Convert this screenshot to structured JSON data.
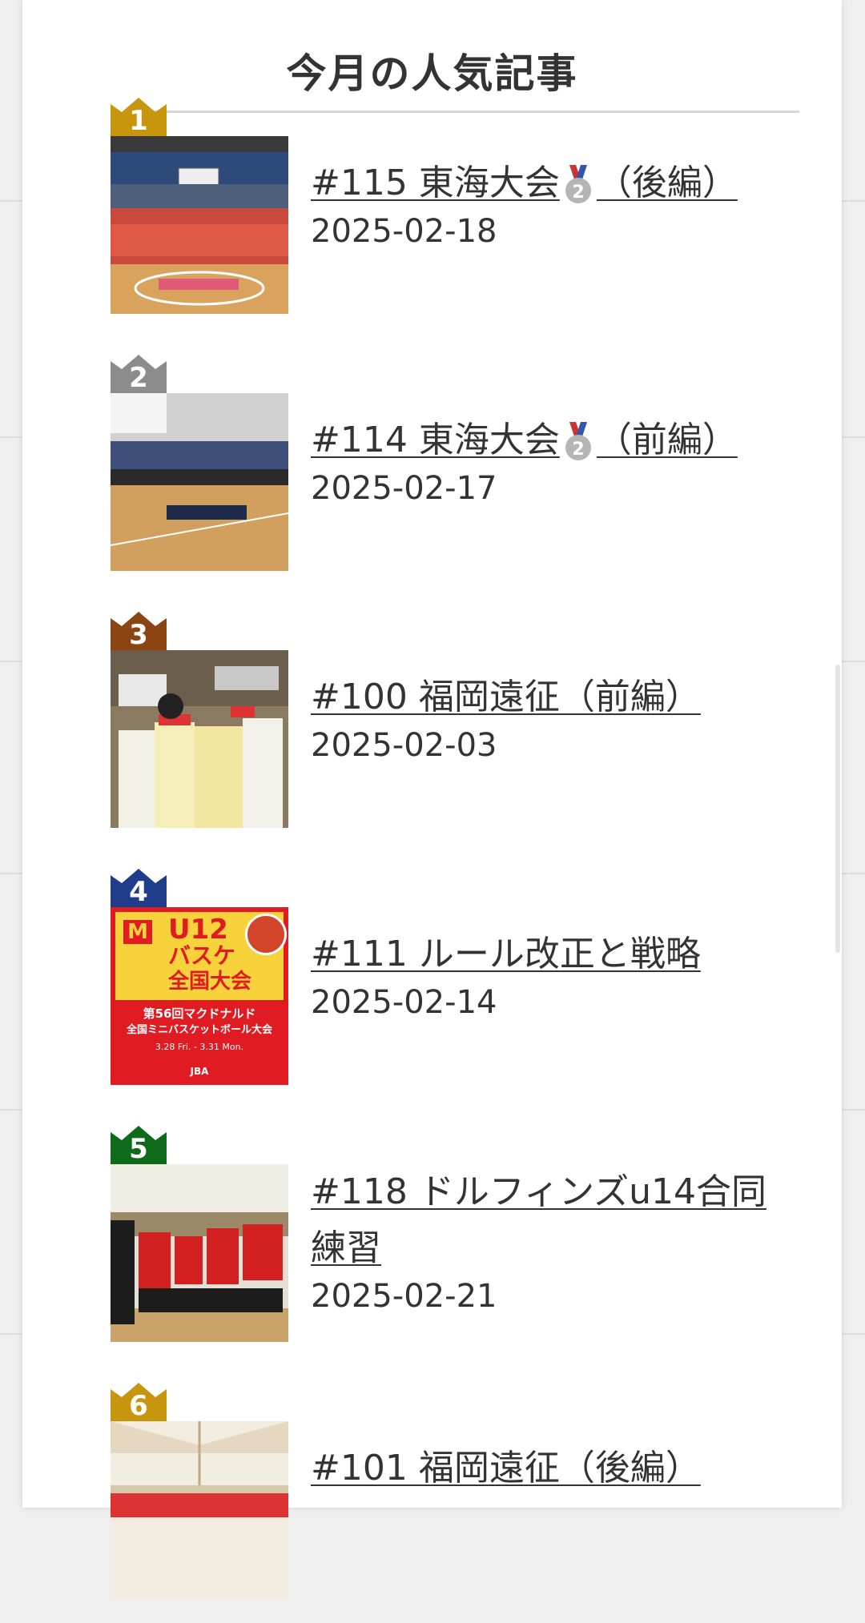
{
  "section_title": "今月の人気記事",
  "crown_colors": {
    "gold": "#c8960c",
    "silver": "#8c8c8c",
    "bronze": "#8b4513",
    "blue": "#1f3d8a",
    "green": "#0d6b1a"
  },
  "articles": [
    {
      "rank": "1",
      "title_before": "#115 東海大会",
      "medal_icon": "silver-medal-2",
      "title_after": "（後編）",
      "date": "2025-02-18"
    },
    {
      "rank": "2",
      "title_before": "#114 東海大会",
      "medal_icon": "silver-medal-2",
      "title_after": "（前編）",
      "date": "2025-02-17"
    },
    {
      "rank": "3",
      "title": "#100 福岡遠征（前編）",
      "date": "2025-02-03"
    },
    {
      "rank": "4",
      "title": "#111 ルール改正と戦略",
      "date": "2025-02-14",
      "poster": {
        "logo": "M",
        "line1": "U12",
        "line2": "バスケ",
        "line3": "全国大会",
        "line4": "第56回マクドナルド",
        "line5": "全国ミニバスケットボール大会",
        "dates": "3.28 Fri. - 3.31 Mon.",
        "footer": "JBA"
      }
    },
    {
      "rank": "5",
      "title": "#118 ドルフィンズu14合同練習",
      "date": "2025-02-21"
    },
    {
      "rank": "6",
      "title": "#101 福岡遠征（後編）"
    }
  ]
}
